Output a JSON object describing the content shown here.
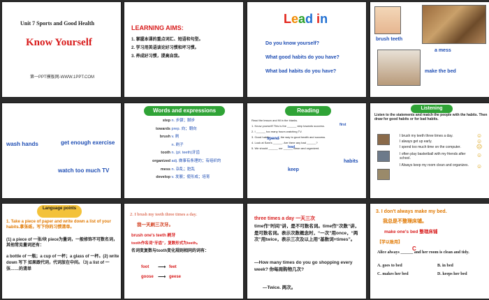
{
  "slides": [
    {
      "number": "1",
      "unit_title": "Unit 7  Sports and Good Health",
      "main_title": "Know Yourself",
      "footer": "第一PPT模板网-WWW.1PPT.COM"
    },
    {
      "number": "2",
      "heading": "LEARNING AIMS:",
      "items": [
        "1. 掌握本课的重点词汇、短语和句型。",
        "2. 学习用英语谈论好习惯和坏习惯。",
        "3. 养成好习惯，提高自我。"
      ]
    },
    {
      "number": "3",
      "heading": "Lead in",
      "questions": [
        "Do you know yourself?",
        "What  good habits do you have?",
        "What  bad habits do you have?"
      ]
    },
    {
      "number": "4",
      "labels": [
        "brush teeth",
        "a mess",
        "make the bed"
      ]
    },
    {
      "number": "5",
      "labels": [
        "wash hands",
        "get enough exercise",
        "watch too much TV"
      ]
    },
    {
      "number": "6",
      "heading": "Words and expressions",
      "words": [
        {
          "word": "step",
          "def": "n. 步骤；脚步"
        },
        {
          "word": "towards",
          "def": "prep. 向；朝向"
        },
        {
          "word": "brush",
          "def": "v. 刷"
        },
        {
          "word": "",
          "def": "n. 刷子"
        },
        {
          "word": "tooth",
          "def": "n. (pl. teeth)牙齿"
        },
        {
          "word": "organized",
          "def": "adj. 做事有条理的；有组织的"
        },
        {
          "word": "mess",
          "def": "n. 杂乱；脏乱"
        },
        {
          "word": "develop",
          "def": "v. 发展；使形成；培育"
        }
      ]
    },
    {
      "number": "7",
      "heading": "Reading",
      "instruction": "Read the lesson and fill in the blanks.",
      "lines": [
        "1. Know yourself! This is the ______ step towards success.",
        "2. I ______ too many hours  watching TV.",
        "3. Good habits ______ the way to good health and success.",
        "4. Look at Sam's ______. Are there any bad ______?",
        "5. We should ______ our ______ clean and organized."
      ],
      "answers": [
        "first",
        "spend",
        "lead",
        "keep",
        "habits"
      ]
    },
    {
      "number": "8",
      "heading": "Listening",
      "instruction": "Listen to the statements and match the people with the habits. Then draw  for good habits or  for bad habits.",
      "statements": [
        "I brush my teeth three times a day.",
        "I always get up early.",
        "I spend too much time on the computer.",
        "I often play basketball with my friends after school.",
        "I Always keep my room clean and organizes."
      ]
    },
    {
      "number": "9",
      "heading": "Language points",
      "text1": "1. Take a piece of paper and write down a list of your habits.拿张纸，写下你的习惯清单。",
      "text2": "(1) a piece of  一张/块 piece为量词，一般修饰不可数名词，其他常见量词还有：",
      "text3": "a bottle  of 一瓶；a cup of 一杯；a glass of 一杯。(2) write down 写下 如果跟代词，代词放在中间。（3) a list of 一张……的清单"
    },
    {
      "number": "10",
      "text1": "2. I brush my teeth three times a day.",
      "text2": "我一天刷三次牙。",
      "text3": "brush one's teeth 刷牙",
      "text4": "tooth作名词“牙齿”，复数形式为teeth。",
      "text5": "名词变复数与tooth变化规则相同的词有：",
      "pairs": [
        {
          "from": "foot",
          "to": "feet"
        },
        {
          "from": "goose",
          "to": "geese"
        }
      ]
    },
    {
      "number": "11",
      "text1": "three times a day  一天三次",
      "text2": "time作“时间”讲，是不可数名词。time作“次数”讲，是可数名词。表示次数概念时，“一次”用once，“两次”用twice，表示三次及以上用“基数词+times”。",
      "text3": "—How many times do you go shopping every week? 你每周购物几次?",
      "text4": "—Twice. 两次。"
    },
    {
      "number": "12",
      "text1": "3. I don't always  make my bed.",
      "text2": "我总是不整理床铺。",
      "text3": "make one's bed   整理床铺",
      "text4": "【学以致用】",
      "question": "Alice always ______ and her room is clean and tidy.",
      "answer": "C",
      "options": [
        "A. goes to bed",
        "B. in bed",
        "C. makes her bed",
        "D. keeps her bed"
      ]
    }
  ]
}
